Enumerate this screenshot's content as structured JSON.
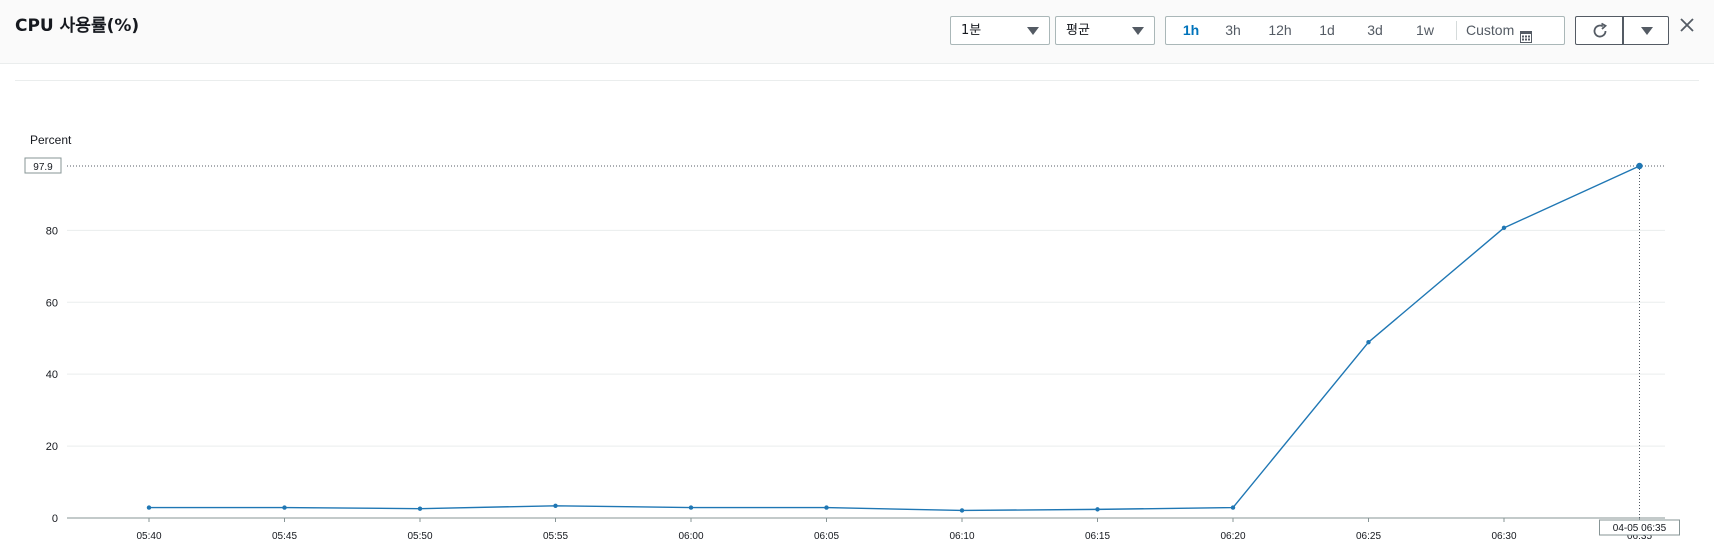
{
  "header": {
    "title": "CPU 사용률(%)",
    "period_select": {
      "value": "1분"
    },
    "stat_select": {
      "value": "평균"
    },
    "time_ranges": [
      {
        "label": "1h",
        "active": true
      },
      {
        "label": "3h",
        "active": false
      },
      {
        "label": "12h",
        "active": false
      },
      {
        "label": "1d",
        "active": false
      },
      {
        "label": "3d",
        "active": false
      },
      {
        "label": "1w",
        "active": false
      }
    ],
    "custom_label": "Custom",
    "icons": {
      "calendar": "calendar-icon",
      "refresh": "refresh-icon",
      "dropdown": "chevron-down-icon",
      "close": "close-icon"
    }
  },
  "colors": {
    "series": "#1f77b4",
    "active_range": "#0073bb",
    "grid": "#eaeded",
    "axis": "#879596"
  },
  "chart_data": {
    "type": "line",
    "ylabel": "Percent",
    "ylim": [
      0,
      97.9
    ],
    "yticks": [
      0,
      20,
      40,
      60,
      80
    ],
    "highlight_y_label": "97.9",
    "x": [
      "05:40",
      "05:45",
      "05:50",
      "05:55",
      "06:00",
      "06:05",
      "06:10",
      "06:15",
      "06:20",
      "06:25",
      "06:30",
      "06:35"
    ],
    "series": [
      {
        "values": [
          2.9,
          2.9,
          2.6,
          3.4,
          2.9,
          2.9,
          2.1,
          2.4,
          2.9,
          48.9,
          80.7,
          97.9
        ]
      }
    ],
    "hover_x_label": "04-05 06:35",
    "hover_index": 11,
    "grid": true
  }
}
